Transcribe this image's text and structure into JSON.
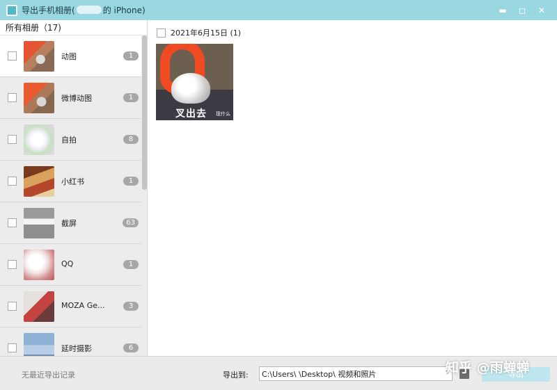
{
  "window": {
    "title_prefix": "导出手机相册(",
    "title_suffix": "的 iPhone)",
    "minimize": "▬",
    "maximize": "◻",
    "close": "✕"
  },
  "sidebar": {
    "header": "所有相册（17)",
    "albums": [
      {
        "name": "动图",
        "count": "1"
      },
      {
        "name": "微博动图",
        "count": "1"
      },
      {
        "name": "自拍",
        "count": "8"
      },
      {
        "name": "小红书",
        "count": "1"
      },
      {
        "name": "截屏",
        "count": "63"
      },
      {
        "name": "QQ",
        "count": "1"
      },
      {
        "name": "MOZA Ge...",
        "count": "3"
      },
      {
        "name": "延时摄影",
        "count": "6"
      }
    ]
  },
  "content": {
    "group_date": "2021年6月15日 (1)",
    "photo_caption": "叉出去",
    "photo_caption_small": "现什么"
  },
  "footer": {
    "history": "无最近导出记录",
    "export_to_label": "导出到:",
    "path": "C:\\Users\\  \\Desktop\\        视频和照片",
    "path_arrow": "▾",
    "export_button": "导出"
  },
  "watermark": "知乎 @雨蝉蝉",
  "colors": {
    "titlebar": "#9ad8e1",
    "badge": "#a7a7a7",
    "export_button": "#bfe6ee"
  },
  "icons": {
    "app": "app-icon",
    "folder": "folder-icon"
  }
}
